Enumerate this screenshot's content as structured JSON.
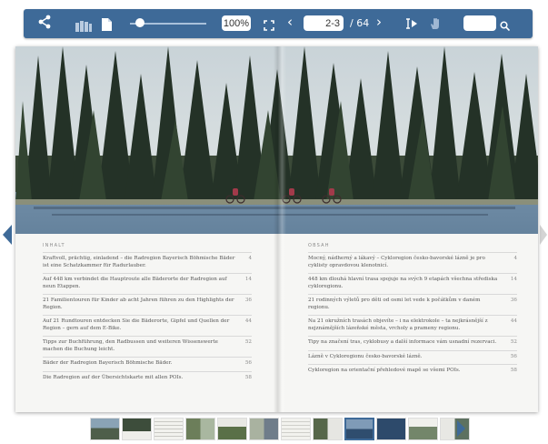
{
  "toolbar": {
    "zoom": "100%",
    "page_input": "2-3",
    "page_total": "/ 64",
    "prev_symbol": "‹",
    "next_symbol": "›",
    "search_value": "",
    "icons": [
      "share-icon",
      "pages-icon",
      "document-icon",
      "fullscreen-icon",
      "text-select-icon",
      "hand-icon",
      "search-icon"
    ]
  },
  "left_page": {
    "heading": "INHALT",
    "items": [
      {
        "text": "Kraftvoll, prächtig, einladend – die Radregion Bayerisch Böhmische Bäder ist eine Schatzkammer für Radurlauber.",
        "page": "4"
      },
      {
        "text": "Auf 448 km verbindet die Hauptroute alle Bäderorte der Radregion auf neun Etappen.",
        "page": "14"
      },
      {
        "text": "21 Familientouren für Kinder ab acht Jahren führen zu den Highlights der Region.",
        "page": "36"
      },
      {
        "text": "Auf 21 Rundtouren entdecken Sie die Bäderorte, Gipfel und Quellen der Region – gern auf dem E-Bike.",
        "page": "44"
      },
      {
        "text": "Tipps zur Buchführung, den Radbussen und weiteren Wissenswerte machen die Buchung leicht.",
        "page": "52"
      },
      {
        "text": "Bäder der Radregion Bayerisch Böhmische Bäder.",
        "page": "56"
      },
      {
        "text": "Die Radregion auf der Übersichtskarte mit allen POIs.",
        "page": "58"
      }
    ]
  },
  "right_page": {
    "heading": "OBSAH",
    "items": [
      {
        "text": "Mocný, nádherný a lákavý – Cykloregion česko-bavorské lázně je pro cyklisty opravdovou klenotnicí.",
        "page": "4"
      },
      {
        "text": "448 km dlouhá hlavní trasa spojuje na svých 9 etapách všechna střediska cykloregionu.",
        "page": "14"
      },
      {
        "text": "21 rodinných výletů pro děti od osmi let vede k počátkům v daném regionu.",
        "page": "36"
      },
      {
        "text": "Na 21 okružních trasách objevíte – i na elektrokole – ta nejkrásnější z nejznámějších lázeňské města, vrcholy a prameny regionu.",
        "page": "44"
      },
      {
        "text": "Tipy na značení tras, cyklobusy a další informace vám usnadní rezervaci.",
        "page": "52"
      },
      {
        "text": "Lázně v Cykloregionu česko-bavorské lázně.",
        "page": "56"
      },
      {
        "text": "Cykloregion na orientační přehledové mapě se všemi POIs.",
        "page": "58"
      }
    ]
  },
  "colors": {
    "toolbar": "#3e6a98",
    "accent": "#3e6a98",
    "water": "#6f8fae",
    "forest": "#2f3c2e"
  }
}
